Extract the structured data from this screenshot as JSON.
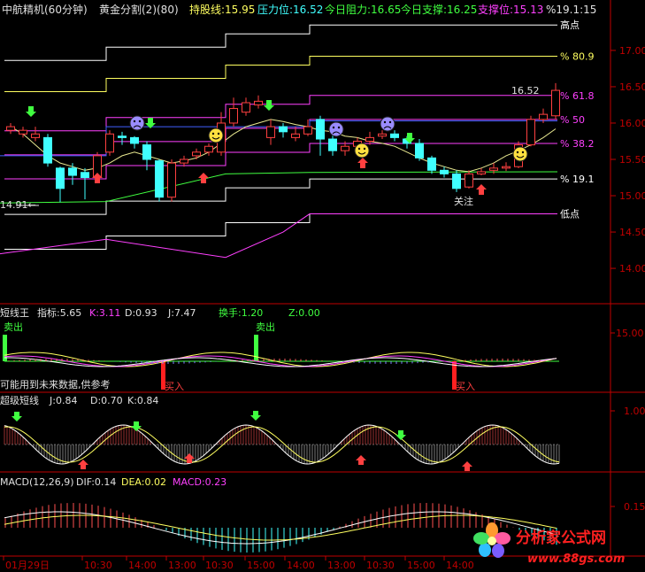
{
  "header": {
    "stock": "中航精机(60分钟)",
    "indicator": "黄金分割(2)(80)",
    "hold_label": "持股线:15.95",
    "pressure": "压力位:16.52",
    "today_resist": "今日阻力:16.65",
    "today_support": "今日支撑:16.25",
    "support": "支撑位:15.13",
    "pct_info": "%19.1:15"
  },
  "colors": {
    "bg": "#000000",
    "grid": "#7a0000",
    "axis": "#c00000",
    "up": "#ff4040",
    "down": "#40ffff",
    "yellow": "#ffff60",
    "green": "#40ff40",
    "magenta": "#ff40ff",
    "blue": "#4060ff",
    "white": "#ffffff",
    "cyan": "#40ffff"
  },
  "panels": {
    "price": {
      "y_ticks": [
        "17.00",
        "16.50",
        "16.00",
        "15.50",
        "15.00",
        "14.50",
        "14.00"
      ],
      "gold_levels": [
        {
          "label": "高点",
          "value": 17.35,
          "color": "#ffffff"
        },
        {
          "label": "80.9",
          "value": 16.92,
          "color": "#ffff60"
        },
        {
          "label": "61.8",
          "value": 16.38,
          "color": "#ff40ff"
        },
        {
          "label": "50",
          "value": 16.05,
          "color": "#ff40ff"
        },
        {
          "label": "38.2",
          "value": 15.72,
          "color": "#ff40ff"
        },
        {
          "label": "19.1",
          "value": 15.23,
          "color": "#ffffff"
        },
        {
          "label": "低点",
          "value": 14.75,
          "color": "#ffffff"
        }
      ],
      "annotations": {
        "price_1652": "16.52",
        "low_1491": "14.91←",
        "follow": "关注"
      },
      "candles": [
        {
          "o": 15.9,
          "c": 15.95,
          "h": 16.0,
          "l": 15.85
        },
        {
          "o": 15.85,
          "c": 15.9,
          "h": 15.95,
          "l": 15.8
        },
        {
          "o": 15.8,
          "c": 15.85,
          "h": 15.95,
          "l": 15.75
        },
        {
          "o": 15.8,
          "c": 15.45,
          "h": 15.85,
          "l": 15.4
        },
        {
          "o": 15.38,
          "c": 15.1,
          "h": 15.4,
          "l": 14.91
        },
        {
          "o": 15.38,
          "c": 15.28,
          "h": 15.45,
          "l": 15.15
        },
        {
          "o": 15.32,
          "c": 15.25,
          "h": 15.38,
          "l": 14.95
        },
        {
          "o": 15.25,
          "c": 15.55,
          "h": 15.6,
          "l": 15.2
        },
        {
          "o": 15.6,
          "c": 15.85,
          "h": 15.9,
          "l": 15.55
        },
        {
          "o": 15.82,
          "c": 15.8,
          "h": 15.88,
          "l": 15.7
        },
        {
          "o": 15.8,
          "c": 15.72,
          "h": 15.82,
          "l": 15.65
        },
        {
          "o": 15.7,
          "c": 15.5,
          "h": 15.75,
          "l": 15.35
        },
        {
          "o": 15.48,
          "c": 14.98,
          "h": 15.5,
          "l": 14.92
        },
        {
          "o": 14.98,
          "c": 15.45,
          "h": 15.5,
          "l": 14.92
        },
        {
          "o": 15.45,
          "c": 15.5,
          "h": 15.55,
          "l": 15.4
        },
        {
          "o": 15.55,
          "c": 15.6,
          "h": 15.65,
          "l": 15.5
        },
        {
          "o": 15.6,
          "c": 15.68,
          "h": 15.72,
          "l": 15.55
        },
        {
          "o": 15.6,
          "c": 16.0,
          "h": 16.15,
          "l": 15.55
        },
        {
          "o": 16.0,
          "c": 16.2,
          "h": 16.35,
          "l": 15.95
        },
        {
          "o": 16.15,
          "c": 16.28,
          "h": 16.35,
          "l": 16.1
        },
        {
          "o": 16.25,
          "c": 16.3,
          "h": 16.38,
          "l": 16.2
        },
        {
          "o": 15.8,
          "c": 15.95,
          "h": 16.05,
          "l": 15.7
        },
        {
          "o": 15.95,
          "c": 15.88,
          "h": 16.0,
          "l": 15.8
        },
        {
          "o": 15.8,
          "c": 15.85,
          "h": 15.95,
          "l": 15.75
        },
        {
          "o": 15.85,
          "c": 15.95,
          "h": 16.05,
          "l": 15.82
        },
        {
          "o": 16.05,
          "c": 15.78,
          "h": 16.1,
          "l": 15.55
        },
        {
          "o": 15.78,
          "c": 15.62,
          "h": 15.85,
          "l": 15.55
        },
        {
          "o": 15.62,
          "c": 15.68,
          "h": 15.75,
          "l": 15.55
        },
        {
          "o": 15.68,
          "c": 15.75,
          "h": 15.8,
          "l": 15.6
        },
        {
          "o": 15.75,
          "c": 15.8,
          "h": 15.88,
          "l": 15.7
        },
        {
          "o": 15.82,
          "c": 15.85,
          "h": 15.9,
          "l": 15.78
        },
        {
          "o": 15.85,
          "c": 15.8,
          "h": 15.9,
          "l": 15.75
        },
        {
          "o": 15.78,
          "c": 15.72,
          "h": 15.82,
          "l": 15.65
        },
        {
          "o": 15.72,
          "c": 15.52,
          "h": 15.78,
          "l": 15.48
        },
        {
          "o": 15.52,
          "c": 15.35,
          "h": 15.55,
          "l": 15.3
        },
        {
          "o": 15.35,
          "c": 15.3,
          "h": 15.4,
          "l": 15.25
        },
        {
          "o": 15.3,
          "c": 15.1,
          "h": 15.35,
          "l": 15.05
        },
        {
          "o": 15.12,
          "c": 15.3,
          "h": 15.35,
          "l": 15.1
        },
        {
          "o": 15.3,
          "c": 15.33,
          "h": 15.38,
          "l": 15.28
        },
        {
          "o": 15.35,
          "c": 15.38,
          "h": 15.45,
          "l": 15.3
        },
        {
          "o": 15.38,
          "c": 15.4,
          "h": 15.46,
          "l": 15.34
        },
        {
          "o": 15.4,
          "c": 15.7,
          "h": 15.75,
          "l": 15.38
        },
        {
          "o": 15.7,
          "c": 16.05,
          "h": 16.1,
          "l": 15.68
        },
        {
          "o": 16.05,
          "c": 16.12,
          "h": 16.2,
          "l": 16.0
        },
        {
          "o": 16.1,
          "c": 16.45,
          "h": 16.55,
          "l": 16.05
        }
      ]
    },
    "short_king": {
      "title": "短线王",
      "index": "指标:5.65",
      "k": "K:3.11",
      "d": "D:0.93",
      "j": "J:7.47",
      "turnover": "换手:1.20",
      "z": "Z:0.00",
      "tick": "15.00",
      "sell1": "卖出",
      "sell2": "卖出",
      "buy1": "买入",
      "buy2": "买入",
      "note": "可能用到未来数据,供参考"
    },
    "super": {
      "title": "超级短线",
      "j": "J:0.84",
      "d": "D:0.70",
      "k": "K:0.84",
      "tick": "1.00"
    },
    "macd": {
      "title": "MACD(12,26,9)",
      "dif": "DIF:0.14",
      "dea": "DEA:0.02",
      "macd": "MACD:0.23",
      "tick": "0.15"
    }
  },
  "time_axis": [
    "01月29日",
    "10:30",
    "14:00",
    "13:00",
    "10:30",
    "15:00",
    "14:00",
    "13:00",
    "10:30",
    "15:00",
    "14:00"
  ],
  "watermark": {
    "site": "分析家公式网",
    "url": "www.88gs.com"
  }
}
